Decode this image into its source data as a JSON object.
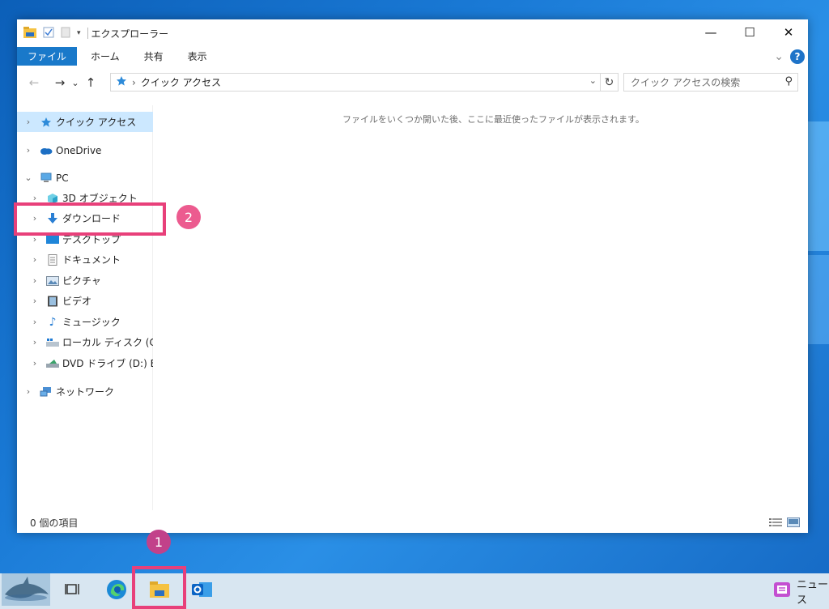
{
  "window": {
    "title": "エクスプローラー",
    "controls": {
      "minimize": "—",
      "maximize": "☐",
      "close": "✕"
    }
  },
  "ribbon": {
    "tabs": [
      "ファイル",
      "ホーム",
      "共有",
      "表示"
    ],
    "collapse_glyph": "⌄",
    "help": "?"
  },
  "navigation": {
    "back": "←",
    "forward": "→",
    "recent": "⌄",
    "up": "↑",
    "address": "クイック アクセス",
    "address_sep": "›",
    "refresh": "↻",
    "search_placeholder": "クイック アクセスの検索"
  },
  "sidebar": {
    "items": [
      {
        "label": "クイック アクセス",
        "icon": "star-icon",
        "chevron": "›",
        "selected": true
      },
      {
        "label": "OneDrive",
        "icon": "cloud-icon",
        "chevron": "›"
      },
      {
        "label": "PC",
        "icon": "pc-icon",
        "chevron": "⌄"
      },
      {
        "label": "3D オブジェクト",
        "icon": "cube-icon",
        "chevron": "›"
      },
      {
        "label": "ダウンロード",
        "icon": "download-arrow-icon",
        "chevron": "›"
      },
      {
        "label": "デスクトップ",
        "icon": "desktop-icon",
        "chevron": "›"
      },
      {
        "label": "ドキュメント",
        "icon": "document-icon",
        "chevron": "›"
      },
      {
        "label": "ピクチャ",
        "icon": "picture-icon",
        "chevron": "›"
      },
      {
        "label": "ビデオ",
        "icon": "video-icon",
        "chevron": "›"
      },
      {
        "label": "ミュージック",
        "icon": "music-note-icon",
        "chevron": "›"
      },
      {
        "label": "ローカル ディスク (C:)",
        "icon": "drive-icon",
        "chevron": "›"
      },
      {
        "label": "DVD ドライブ (D:) ESI",
        "icon": "dvd-icon",
        "chevron": "›"
      },
      {
        "label": "ネットワーク",
        "icon": "network-icon",
        "chevron": "›"
      }
    ]
  },
  "main": {
    "empty_message": "ファイルをいくつか開いた後、ここに最近使ったファイルが表示されます。"
  },
  "status": {
    "item_count": "0 個の項目"
  },
  "annotations": {
    "badge_1": "1",
    "badge_2": "2",
    "highlight_color": "#e8407a",
    "badge_1_color": "#c2418a",
    "badge_2_color": "#ec5b8f"
  },
  "taskbar": {
    "items": [
      "dolphin-widget-icon",
      "task-view-icon",
      "edge-icon",
      "file-explorer-icon",
      "outlook-icon"
    ],
    "news_label": "ニュース"
  },
  "colors": {
    "accent": "#1979ca",
    "selection": "#cce8ff",
    "taskbar": "#d8e6f1"
  }
}
